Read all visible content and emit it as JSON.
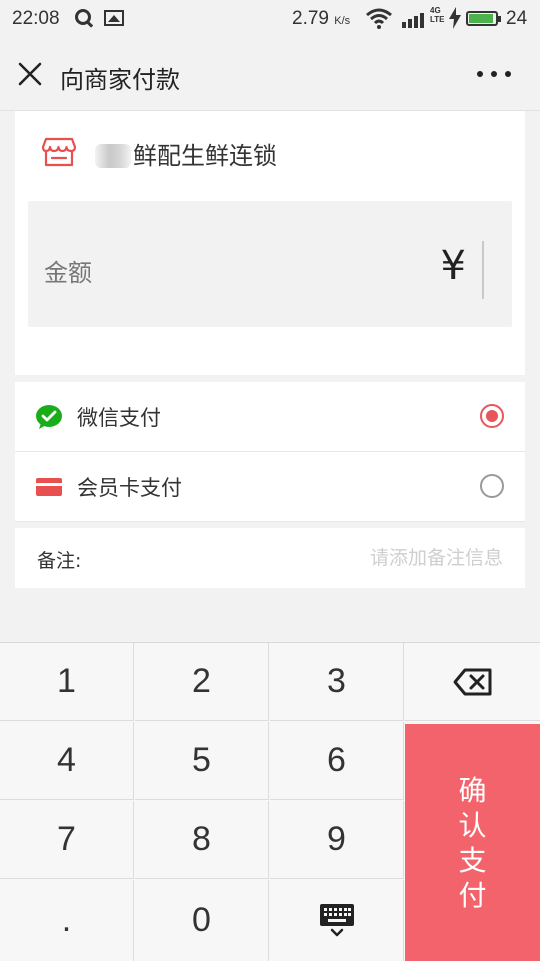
{
  "status_bar": {
    "time": "22:08",
    "speed": "2.79",
    "speed_unit": "K/s",
    "network": "4G",
    "network_sub": "LTE",
    "battery_level": "24"
  },
  "nav": {
    "title": "向商家付款"
  },
  "merchant": {
    "name": "鲜配生鲜连锁"
  },
  "amount": {
    "label": "金额",
    "currency_symbol": "¥"
  },
  "payment": {
    "options": [
      {
        "label": "微信支付",
        "selected": true,
        "icon": "wechat-pay-icon"
      },
      {
        "label": "会员卡支付",
        "selected": false,
        "icon": "member-card-icon"
      }
    ]
  },
  "remark": {
    "label": "备注:",
    "placeholder": "请添加备注信息"
  },
  "keypad": {
    "keys": [
      "1",
      "2",
      "3",
      "4",
      "5",
      "6",
      "7",
      "8",
      "9",
      ".",
      "0"
    ],
    "confirm_label": "确认支付"
  },
  "colors": {
    "accent": "#f2636b",
    "radio_selected": "#e8565a",
    "wechat_green": "#1aad19",
    "card_red": "#e84f4f"
  }
}
